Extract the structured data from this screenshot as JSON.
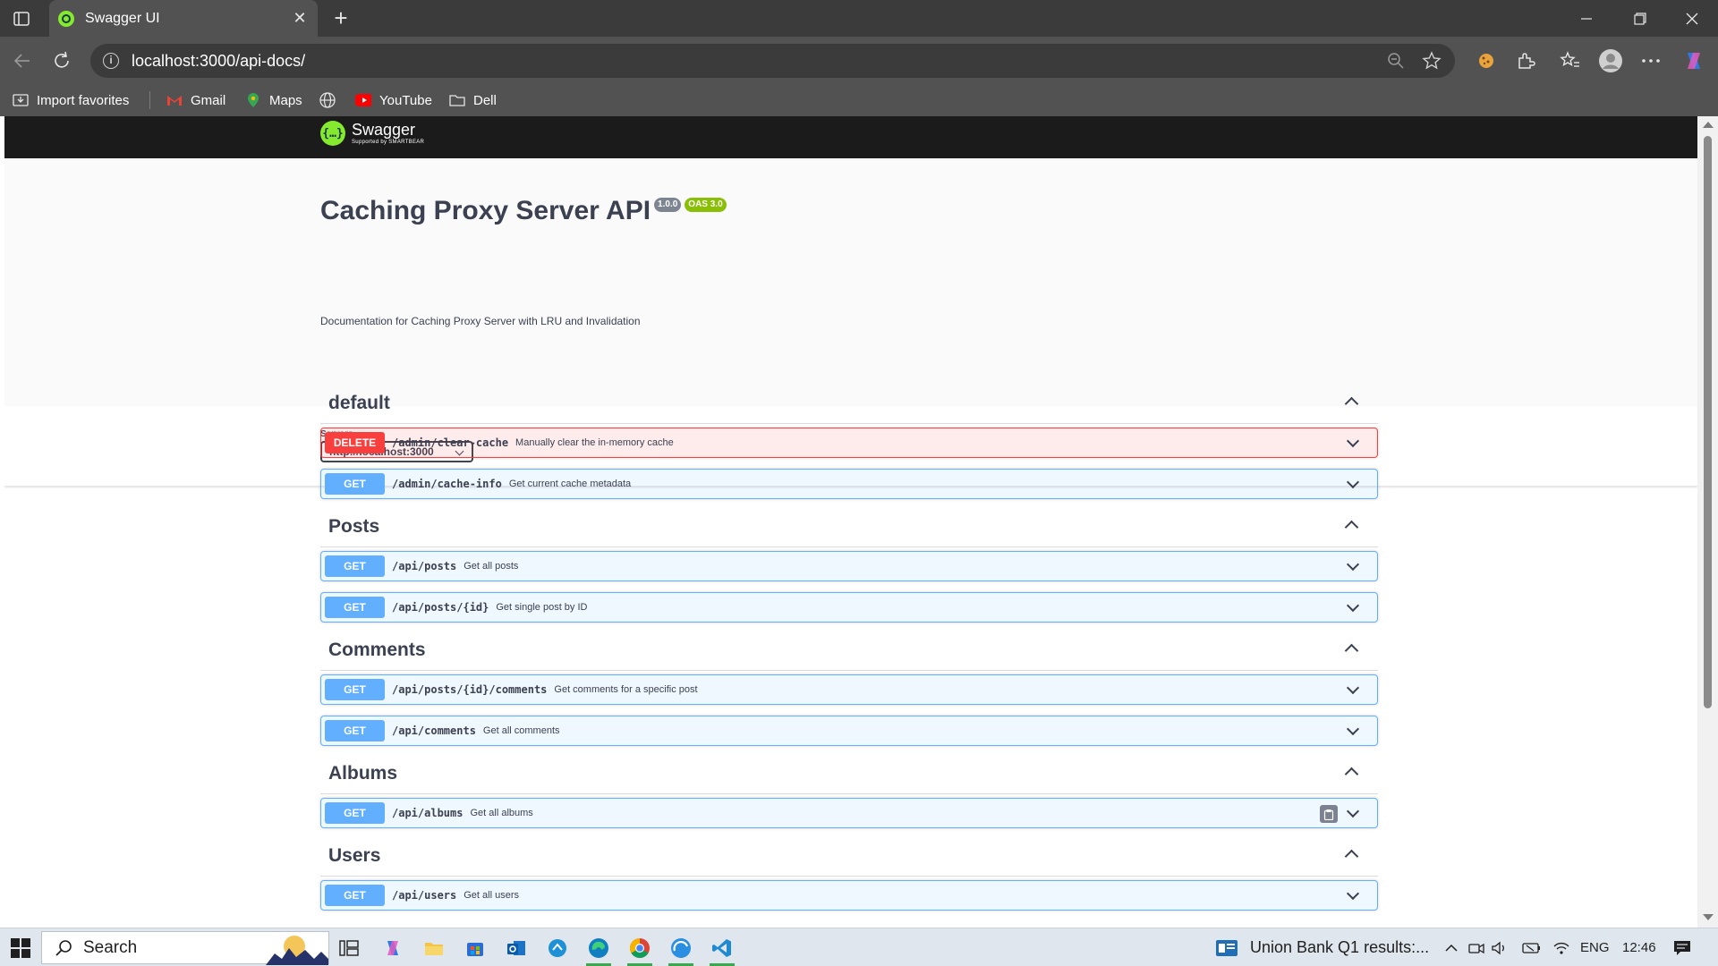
{
  "browser": {
    "tab_title": "Swagger UI",
    "url": "localhost:3000/api-docs/",
    "bookmarks": [
      "Import favorites",
      "Gmail",
      "Maps",
      "YouTube",
      "Dell"
    ]
  },
  "swagger": {
    "logo_name": "Swagger",
    "logo_sub": "Supported by SMARTBEAR",
    "title": "Caching Proxy Server API",
    "version": "1.0.0",
    "oas": "OAS 3.0",
    "description": "Documentation for Caching Proxy Server with LRU and Invalidation",
    "servers_label": "Servers",
    "server_selected": "http://localhost:3000"
  },
  "tags": [
    {
      "name": "default",
      "operations": [
        {
          "method": "DELETE",
          "path": "/admin/clear-cache",
          "summary": "Manually clear the in-memory cache"
        },
        {
          "method": "GET",
          "path": "/admin/cache-info",
          "summary": "Get current cache metadata"
        }
      ]
    },
    {
      "name": "Posts",
      "operations": [
        {
          "method": "GET",
          "path": "/api/posts",
          "summary": "Get all posts"
        },
        {
          "method": "GET",
          "path": "/api/posts/{id}",
          "summary": "Get single post by ID"
        }
      ]
    },
    {
      "name": "Comments",
      "operations": [
        {
          "method": "GET",
          "path": "/api/posts/{id}/comments",
          "summary": "Get comments for a specific post"
        },
        {
          "method": "GET",
          "path": "/api/comments",
          "summary": "Get all comments"
        }
      ]
    },
    {
      "name": "Albums",
      "operations": [
        {
          "method": "GET",
          "path": "/api/albums",
          "summary": "Get all albums"
        }
      ]
    },
    {
      "name": "Users",
      "operations": [
        {
          "method": "GET",
          "path": "/api/users",
          "summary": "Get all users"
        }
      ]
    }
  ],
  "taskbar": {
    "search_label": "Search",
    "news": "Union Bank Q1 results:...",
    "language": "ENG",
    "time": "12:46"
  },
  "colors": {
    "get": "#61affe",
    "delete": "#f93e3e",
    "swagger_green": "#85ea2d",
    "oas_badge": "#89bf04"
  }
}
